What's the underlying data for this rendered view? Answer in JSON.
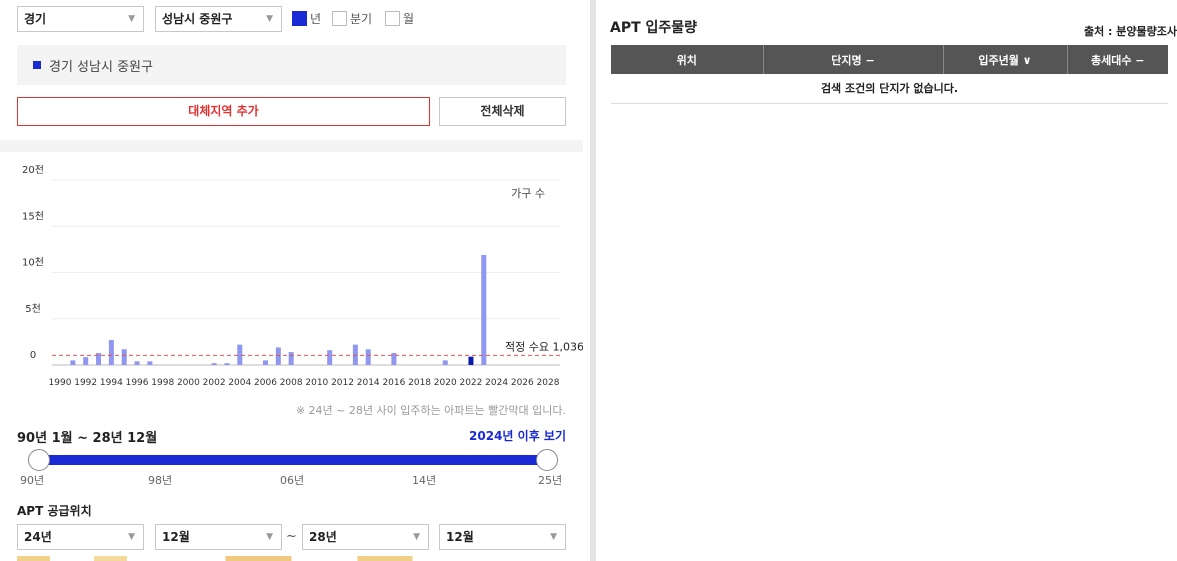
{
  "filters": {
    "province": "경기",
    "district": "성남시 중원구",
    "period_options": [
      {
        "label": "년",
        "checked": true
      },
      {
        "label": "분기",
        "checked": false
      },
      {
        "label": "월",
        "checked": false
      }
    ]
  },
  "selected_region": "경기 성남시 중원구",
  "buttons": {
    "add_region": "대체지역 추가",
    "delete_all": "전체삭제"
  },
  "chart_data": {
    "type": "bar",
    "legend_label": "가구 수",
    "y_ticks": [
      "0",
      "5천",
      "10천",
      "15천",
      "20천"
    ],
    "ylim": [
      0,
      20000
    ],
    "x_tick_labels": [
      "1990",
      "1992",
      "1994",
      "1996",
      "1998",
      "2000",
      "2002",
      "2004",
      "2006",
      "2008",
      "2010",
      "2012",
      "2014",
      "2016",
      "2018",
      "2020",
      "2022",
      "2024",
      "2026",
      "2028"
    ],
    "years": [
      1990,
      1991,
      1992,
      1993,
      1994,
      1995,
      1996,
      1997,
      1998,
      1999,
      2000,
      2001,
      2002,
      2003,
      2004,
      2005,
      2006,
      2007,
      2008,
      2009,
      2010,
      2011,
      2012,
      2013,
      2014,
      2015,
      2016,
      2017,
      2018,
      2019,
      2020,
      2021,
      2022,
      2023,
      2024,
      2025,
      2026,
      2027,
      2028
    ],
    "values": [
      0,
      500,
      850,
      1300,
      2700,
      1700,
      400,
      400,
      0,
      0,
      0,
      0,
      200,
      200,
      2200,
      0,
      500,
      1900,
      1400,
      0,
      0,
      1600,
      0,
      2200,
      1700,
      0,
      1300,
      0,
      0,
      0,
      500,
      0,
      900,
      11900,
      0,
      0,
      0,
      0,
      0
    ],
    "highlight_year": 2022,
    "reference_line": {
      "value": 1036,
      "label": "적정 수요 1,036"
    },
    "colors": {
      "bar": "#8f97f0",
      "highlight": "#0b1aa8",
      "reference": "#e05555"
    }
  },
  "note": "※ 24년 ~ 28년 사이 입주하는 아파트는 빨간막대 입니다.",
  "range": {
    "label": "90년 1월 ~ 28년 12월",
    "after_link": "2024년 이후 보기",
    "slider_ticks": [
      "90년",
      "98년",
      "06년",
      "14년",
      "25년"
    ]
  },
  "supply": {
    "title": "APT 공급위치",
    "from_year": "24년",
    "from_month": "12월",
    "tilde": "~",
    "to_year": "28년",
    "to_month": "12월"
  },
  "right_panel": {
    "title": "APT 입주물량",
    "source": "출처 : 분양물량조사",
    "columns": [
      "위치",
      "단지명 −",
      "입주년월 ∨",
      "총세대수 −"
    ],
    "empty_message": "검색 조건의 단지가 없습니다."
  },
  "colors": {
    "accent": "#1a2bd6",
    "danger": "#e23232",
    "header_bg": "#555555"
  }
}
